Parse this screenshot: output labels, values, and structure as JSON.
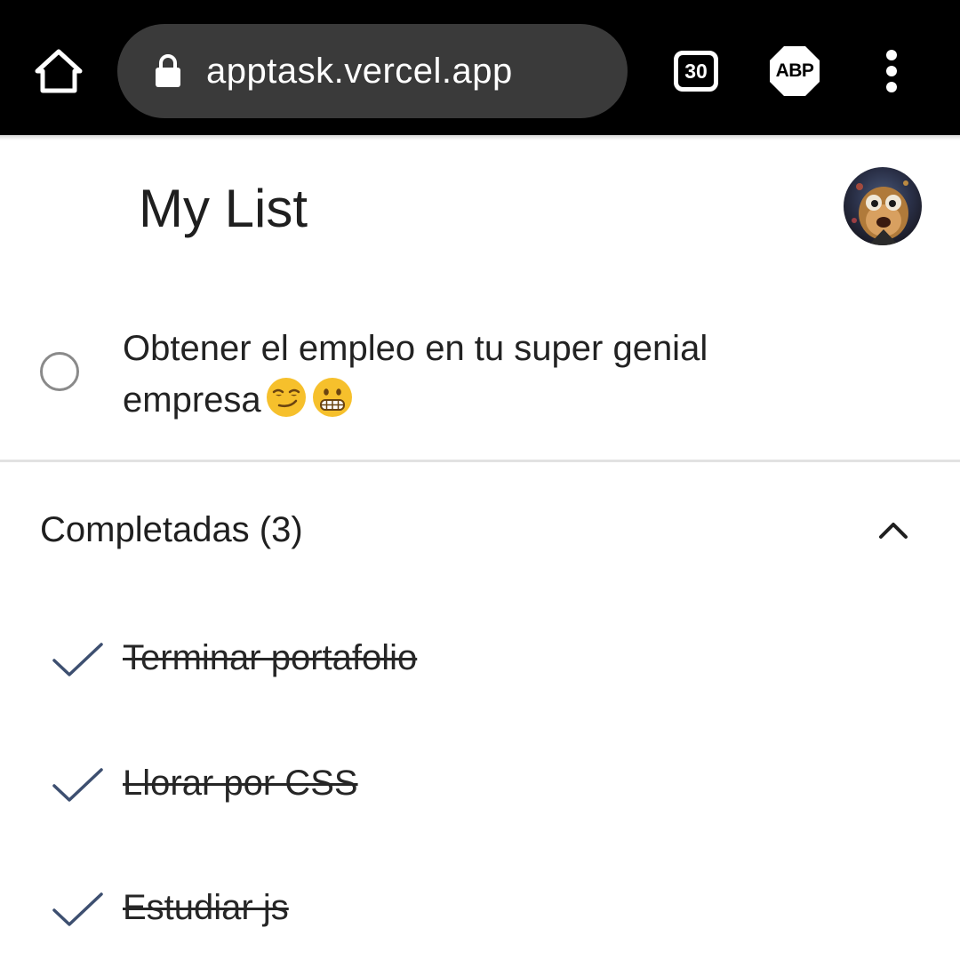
{
  "browser": {
    "url": "apptask.vercel.app",
    "tab_count": "30",
    "adblock_label": "ABP",
    "icons": [
      "home-icon",
      "lock-icon",
      "tab-switcher-icon",
      "adblock-icon",
      "overflow-menu-icon"
    ]
  },
  "app": {
    "title": "My List",
    "avatar_alt": "avatar"
  },
  "tasks": [
    {
      "text": "Obtener el empleo en tu super genial empresa",
      "emojis": [
        "smirk-emoji",
        "grimace-emoji"
      ],
      "done": false
    }
  ],
  "completed": {
    "label": "Completadas (3)",
    "expanded": true,
    "items": [
      {
        "text": "Terminar portafolio"
      },
      {
        "text": "Llorar por CSS"
      },
      {
        "text": "Estudiar js"
      }
    ]
  },
  "colors": {
    "toolbar_bg": "#000000",
    "urlbar_bg": "#3a3a3a",
    "check": "#3d4f70",
    "text": "#1f1f1f"
  }
}
